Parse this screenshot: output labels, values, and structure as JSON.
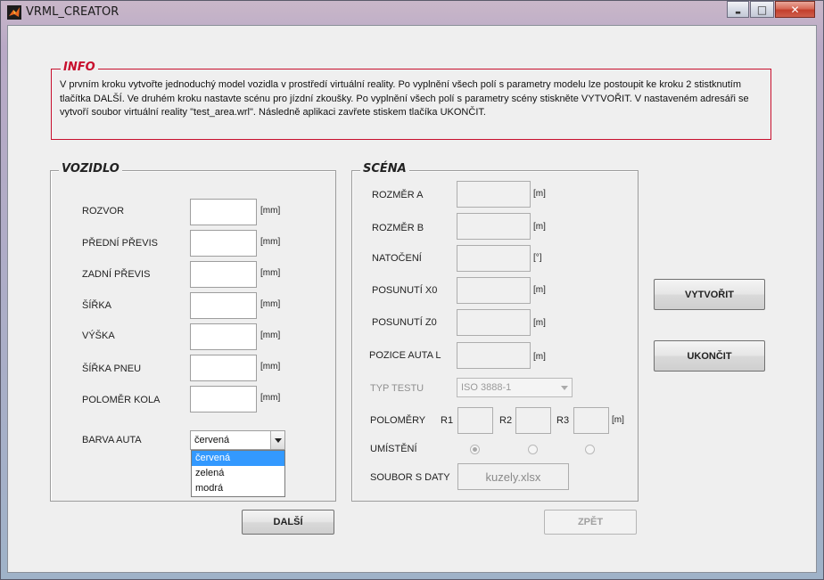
{
  "window": {
    "title": "VRML_CREATOR",
    "minimize_glyph": "▬",
    "maximize_glyph": "□",
    "close_glyph": "✕"
  },
  "info": {
    "legend": "INFO",
    "text": "V prvním kroku vytvořte jednoduchý model vozidla v prostředí virtuální reality. Po vyplnění všech polí s parametry modelu lze postoupit ke kroku 2 stistknutím tlačítka DALŠÍ. Ve druhém kroku nastavte scénu pro jízdní zkoušky. Po vyplnění všech polí s parametry scény stiskněte VYTVOŘIT. V nastaveném adresáři se vytvoří soubor virtuální reality \"test_area.wrl\". Následně aplikaci zavřete stiskem tlačíka UKONČIT."
  },
  "vozidlo": {
    "legend": "VOZIDLO",
    "fields": [
      {
        "label": "ROZVOR",
        "unit": "[mm]",
        "value": ""
      },
      {
        "label": "PŘEDNÍ PŘEVIS",
        "unit": "[mm]",
        "value": ""
      },
      {
        "label": "ZADNÍ PŘEVIS",
        "unit": "[mm]",
        "value": ""
      },
      {
        "label": "ŠÍŘKA",
        "unit": "[mm]",
        "value": ""
      },
      {
        "label": "VÝŠKA",
        "unit": "[mm]",
        "value": ""
      },
      {
        "label": "ŠÍŘKA PNEU",
        "unit": "[mm]",
        "value": ""
      },
      {
        "label": "POLOMĚR KOLA",
        "unit": "[mm]",
        "value": ""
      }
    ],
    "color_label": "BARVA AUTA",
    "color_selected": "červená",
    "color_options": [
      "červená",
      "zelená",
      "modrá"
    ]
  },
  "scena": {
    "legend": "SCÉNA",
    "fields": [
      {
        "label": "ROZMĚR A",
        "unit": "[m]",
        "value": ""
      },
      {
        "label": "ROZMĚR B",
        "unit": "[m]",
        "value": ""
      },
      {
        "label": "NATOČENÍ",
        "unit": "[°]",
        "value": ""
      },
      {
        "label": "POSUNUTÍ X0",
        "unit": "[m]",
        "value": ""
      },
      {
        "label": "POSUNUTÍ Z0",
        "unit": "[m]",
        "value": ""
      },
      {
        "label": "POZICE AUTA L",
        "unit": "[m]",
        "value": ""
      }
    ],
    "test_type_label": "TYP TESTU",
    "test_type_value": "ISO 3888-1",
    "radii_label": "POLOMĚRY",
    "r1_label": "R1",
    "r2_label": "R2",
    "r3_label": "R3",
    "radii_unit": "[m]",
    "placement_label": "UMÍSTĚNÍ",
    "data_file_label": "SOUBOR S DATY",
    "data_file_value": "kuzely.xlsx"
  },
  "buttons": {
    "create": "VYTVOŘIT",
    "quit": "UKONČIT",
    "next": "DALŠÍ",
    "back": "ZPĚT"
  },
  "colors": {
    "info_accent": "#c8102e",
    "selection": "#3399ff",
    "client_bg": "#efefef"
  }
}
